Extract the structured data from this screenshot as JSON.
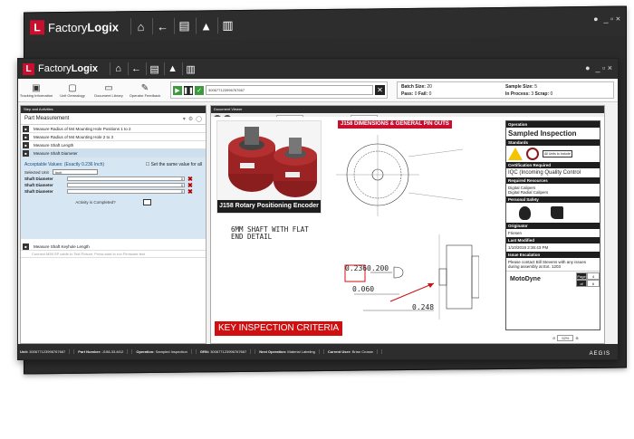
{
  "app": {
    "logo_letter": "L",
    "name_light": "Factory",
    "name_bold": "Logix",
    "window_controls": "_ ▫ ×"
  },
  "toolbar": {
    "tools": [
      {
        "label": "Tracking Information",
        "icon": "tracking-icon"
      },
      {
        "label": "Unit Genealogy",
        "icon": "genealogy-icon"
      },
      {
        "label": "Document Library",
        "icon": "library-icon"
      },
      {
        "label": "Operator Feedback",
        "icon": "feedback-icon"
      }
    ],
    "scan_value": "300677123996767667"
  },
  "batch": {
    "batch_size_label": "Batch Size:",
    "batch_size": "20",
    "sample_size_label": "Sample Size:",
    "sample_size": "5",
    "pass_label": "Pass:",
    "pass": "0",
    "fail_label": "Fail:",
    "fail": "0",
    "in_process_label": "In Process:",
    "in_process": "3",
    "scrap_label": "Scrap:",
    "scrap": "0"
  },
  "left": {
    "panel_title": "Step and Activities",
    "measurement_title": "Part Measurement",
    "tasks": [
      "Measure Radius of M4 Mounting Hole Positions 1 to 2",
      "Measure Radius of M4 Mounting Hole 2 to 3",
      "Measure Shaft Length",
      "Measure Shaft Diameter"
    ],
    "acceptable": "Acceptable Values: (Exactly 0.236 Inch)",
    "same_value": "Set the same value for all",
    "units_label": "Selected Unit",
    "units_value": "Inch",
    "fields": [
      {
        "label": "Shaft Diameter",
        "value": "0"
      },
      {
        "label": "Shaft Diameter",
        "value": "0"
      },
      {
        "label": "Shaft Diameter",
        "value": "0"
      }
    ],
    "activity_complete": "Activity is Completed?",
    "next_task": "Measure Shaft Keyhole Length",
    "next_hint": "Connect M55 SP cable to Test Fixture, Press start to run Firmware test"
  },
  "doc": {
    "panel_title": "Document Viewer",
    "documents_label": "Documents",
    "search_label": "Search:",
    "inspection_code_label": "Inspection Code",
    "photo_caption": "J158 Rotary Positioning Encoder",
    "dimensions_banner": "J158 DIMENSIONS & GENERAL PIN OUTS",
    "shaft_text_1": "6MM SHAFT WITH FLAT",
    "shaft_text_2": "END DETAIL",
    "dim_1": "0.236",
    "dim_2": "0.200",
    "dim_3": "0.060",
    "dim_4": "0.248",
    "key_criteria": "KEY INSPECTION CRITERIA"
  },
  "side": {
    "operation_head": "Operation",
    "operation": "Sampled Inspection",
    "standards_head": "Standards",
    "ul_text": "All Units to Include",
    "cert_head": "Certification Required",
    "cert": "IQC (Incoming Quality Control",
    "resources_head": "Required Resources",
    "resource_1": "Digital Calipers",
    "resource_2": "Digital Radial Calipers",
    "safety_head": "Personal Safety",
    "originator_head": "Originator",
    "originator": "Friesen",
    "modified_head": "Last Modified",
    "modified": "1/10/2019 2:36:43 PM",
    "escalation_head": "Issue Escalation",
    "escalation": "Please contact Bill Stevens with any issues during assembly at Ext. 1203",
    "brand": "MotoDyne",
    "page_label": "Page",
    "page_value": "4",
    "of_label": "of",
    "of_value": "6"
  },
  "zoom": "52%",
  "status": {
    "unit_label": "Unit:",
    "unit": "300677123996767667",
    "part_label": "Part Number:",
    "part": "J158-33-M12",
    "operation_label": "Operation:",
    "operation": "Sampled Inspection",
    "grn_label": "GRN:",
    "grn": "300677123996767667",
    "next_label": "Next Operation:",
    "next": "Material Labeling",
    "user_label": "Current User:",
    "user": "Brian Crosse",
    "brand": "AEGIS"
  }
}
